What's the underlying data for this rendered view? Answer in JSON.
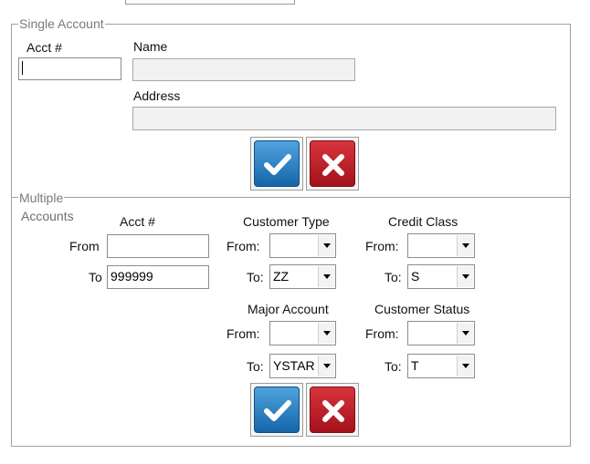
{
  "single_account": {
    "legend": "Single Account",
    "acct_label": "Acct #",
    "acct_value": "",
    "name_label": "Name",
    "name_value": "",
    "address_label": "Address",
    "address_value": ""
  },
  "multiple_accounts": {
    "legend_line1": "Multiple",
    "legend_line2": "Accounts",
    "acct_header": "Acct #",
    "from_label": "From",
    "to_label": "To",
    "acct_from": "",
    "acct_to": "999999",
    "customer_type": {
      "header": "Customer Type",
      "from_label": "From:",
      "to_label": "To:",
      "from_value": "",
      "to_value": "ZZ"
    },
    "credit_class": {
      "header": "Credit Class",
      "from_label": "From:",
      "to_label": "To:",
      "from_value": "",
      "to_value": "S"
    },
    "major_account": {
      "header": "Major Account",
      "from_label": "From:",
      "to_label": "To:",
      "from_value": "",
      "to_value": "YSTAR"
    },
    "customer_status": {
      "header": "Customer Status",
      "from_label": "From:",
      "to_label": "To:",
      "from_value": "",
      "to_value": "T"
    }
  },
  "icons": {
    "ok": "check-icon",
    "cancel": "x-icon"
  },
  "colors": {
    "ok_button": "#1e74b8",
    "cancel_button": "#c21f29",
    "frame": "#a0a0a0"
  }
}
